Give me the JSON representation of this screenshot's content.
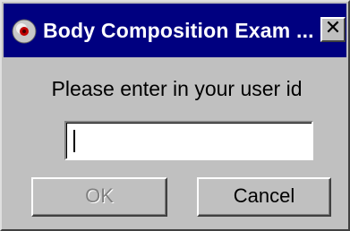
{
  "window": {
    "title": "Body Composition Exam ...",
    "close_label": "✕",
    "icon": "app-disc-icon"
  },
  "dialog": {
    "prompt": "Please enter in your user id",
    "userid_value": "",
    "ok_label": "OK",
    "ok_enabled": false,
    "cancel_label": "Cancel"
  },
  "colors": {
    "titlebar": "#000080",
    "titlebar_text": "#ffffff",
    "face": "#c0c0c0",
    "disabled_text": "#808080"
  }
}
